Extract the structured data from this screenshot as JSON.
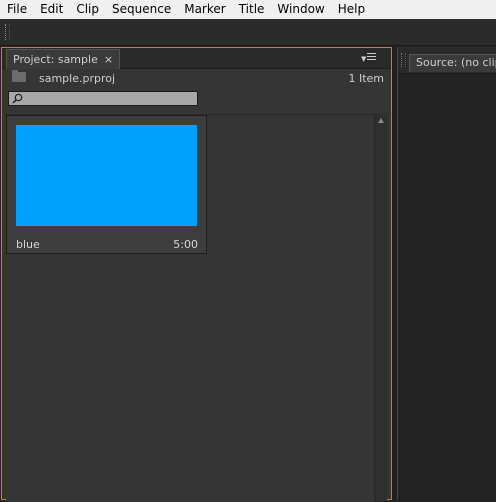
{
  "menu": {
    "items": [
      "File",
      "Edit",
      "Clip",
      "Sequence",
      "Marker",
      "Title",
      "Window",
      "Help"
    ]
  },
  "project_panel": {
    "tab_label": "Project: sample",
    "close_glyph": "×",
    "project_file": "sample.prproj",
    "item_count": "1 Item",
    "search": {
      "value": "",
      "placeholder": ""
    },
    "items": [
      {
        "name": "blue",
        "duration": "5:00",
        "thumbnail_color": "#00a0ff"
      }
    ]
  },
  "source_panel": {
    "tab_label": "Source: (no clips)"
  },
  "colors": {
    "panel_highlight": "#b98a2b",
    "clip_thumbnail": "#00a0ff"
  }
}
